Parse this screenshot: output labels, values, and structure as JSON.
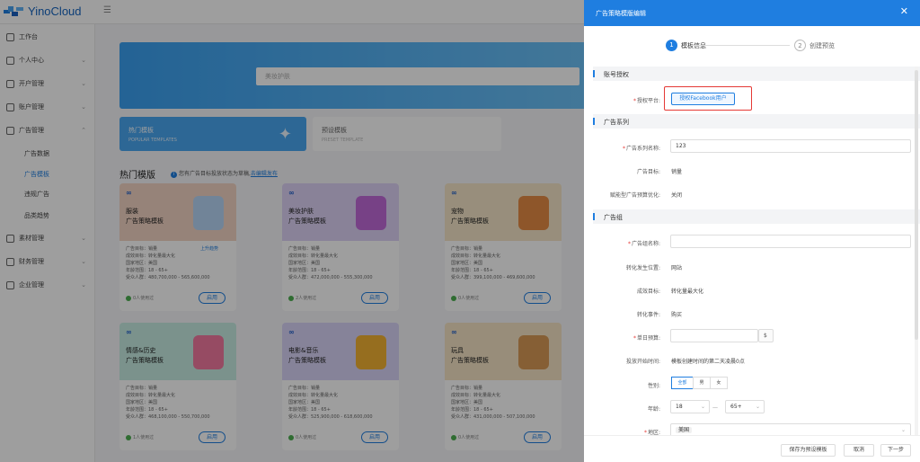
{
  "app": {
    "logo_text": "YinoCloud"
  },
  "sidebar": {
    "items": [
      {
        "label": "工作台",
        "icon": "home-icon",
        "arrow": ""
      },
      {
        "label": "个人中心",
        "icon": "user-icon",
        "arrow": "⌄"
      },
      {
        "label": "开户管理",
        "icon": "account-open-icon",
        "arrow": "⌄"
      },
      {
        "label": "账户管理",
        "icon": "account-icon",
        "arrow": "⌄"
      },
      {
        "label": "广告管理",
        "icon": "ad-icon",
        "arrow": "⌃"
      },
      {
        "label": "素材管理",
        "icon": "material-icon",
        "arrow": "⌄"
      },
      {
        "label": "财务管理",
        "icon": "finance-icon",
        "arrow": "⌄"
      },
      {
        "label": "企业管理",
        "icon": "company-icon",
        "arrow": "⌄"
      }
    ],
    "subitems": [
      {
        "label": "广告数据",
        "active": false
      },
      {
        "label": "广告模板",
        "active": true
      },
      {
        "label": "违规广告",
        "active": false
      },
      {
        "label": "品类趋势",
        "active": false
      }
    ]
  },
  "main": {
    "search_placeholder": "美妆护肤",
    "tabs": [
      {
        "label": "热门模板",
        "sub": "POPULAR TEMPLATES"
      },
      {
        "label": "预设模板",
        "sub": "PRESET TEMPLATE"
      }
    ],
    "section_title": "热门模版",
    "notice": "您有广告目标投放状态为草稿,",
    "notice_link": "去编辑发布",
    "cards": [
      {
        "name": "服装",
        "subtitle": "广告策略模板",
        "color": "#f3d4c4",
        "art": "#b7d6f5",
        "specs": [
          "广告目标：销量",
          "成效目标：转化量最大化",
          "国家地区：美国",
          "年龄范围：18 - 65+",
          "受众人群：480,700,000 - 565,600,000"
        ],
        "used": "0人使用过",
        "btn": "启用",
        "trend": "上升趋势"
      },
      {
        "name": "美妆护肤",
        "subtitle": "广告策略模板",
        "color": "#ddd2f5",
        "art": "#c06ad8",
        "specs": [
          "广告目标：销量",
          "成效目标：转化量最大化",
          "国家地区：美国",
          "年龄范围：18 - 65+",
          "受众人群：472,000,000 - 555,300,000"
        ],
        "used": "2人使用过",
        "btn": "启用",
        "trend": ""
      },
      {
        "name": "宠物",
        "subtitle": "广告策略模板",
        "color": "#f5e6c8",
        "art": "#e58b45",
        "specs": [
          "广告目标：销量",
          "成效目标：转化量最大化",
          "国家地区：美国",
          "年龄范围：18 - 65+",
          "受众人群：399,100,000 - 469,600,000"
        ],
        "used": "0人使用过",
        "btn": "启用",
        "trend": ""
      },
      {
        "name": "情感&历史",
        "subtitle": "广告策略模板",
        "color": "#c7ece3",
        "art": "#f27aa0",
        "specs": [
          "广告目标：销量",
          "成效目标：转化量最大化",
          "国家地区：美国",
          "年龄范围：18 - 65+",
          "受众人群：468,100,000 - 550,700,000"
        ],
        "used": "1人使用过",
        "btn": "启用",
        "trend": ""
      },
      {
        "name": "电影&音乐",
        "subtitle": "广告策略模板",
        "color": "#d9d4f7",
        "art": "#f2b233",
        "specs": [
          "广告目标：销量",
          "成效目标：转化量最大化",
          "国家地区：美国",
          "年龄范围：18 - 65+",
          "受众人群：525,900,000 - 618,600,000"
        ],
        "used": "0人使用过",
        "btn": "启用",
        "trend": ""
      },
      {
        "name": "玩具",
        "subtitle": "广告策略模板",
        "color": "#f5e4c5",
        "art": "#d99a56",
        "specs": [
          "广告目标：销量",
          "成效目标：转化量最大化",
          "国家地区：美国",
          "年龄范围：18 - 65+",
          "受众人群：431,000,000 - 507,100,000"
        ],
        "used": "0人使用过",
        "btn": "启用",
        "trend": ""
      }
    ]
  },
  "drawer": {
    "title": "广告策略模版编辑",
    "close": "✕",
    "steps": [
      {
        "num": "1",
        "label": "模板信息"
      },
      {
        "num": "2",
        "label": "创建预览"
      }
    ],
    "sections": {
      "account": "账号授权",
      "campaign": "广告系列",
      "adset": "广告组"
    },
    "auth": {
      "label": "授权平台:",
      "button": "授权Facebook用户"
    },
    "campaign": {
      "name_label": "广告系列名称:",
      "name_value": "123",
      "goal_label": "广告目标:",
      "goal_value": "销量",
      "budget_opt_label": "赋能型广告预算优化:",
      "budget_opt_value": "关闭"
    },
    "adset": {
      "name_label": "广告组名称:",
      "name_value": "",
      "conv_loc_label": "转化发生位置:",
      "conv_loc_value": "网站",
      "perf_goal_label": "成效目标:",
      "perf_goal_value": "转化量最大化",
      "conv_event_label": "转化事件:",
      "conv_event_value": "购买",
      "daily_budget_label": "单日预算:",
      "daily_budget_value": "",
      "currency": "$",
      "start_time_label": "投放开始时间:",
      "start_time_value": "模板创建时间的第二天凌晨0点",
      "gender_label": "性别:",
      "gender_options": [
        "全部",
        "男",
        "女"
      ],
      "age_label": "年龄:",
      "age_min": "18",
      "age_max": "65+",
      "age_sep": "—",
      "region_label": "地区:",
      "region_tag": "美国"
    },
    "footer": {
      "save_preset": "保存为预设模板",
      "cancel": "取消",
      "next": "下一步"
    }
  }
}
